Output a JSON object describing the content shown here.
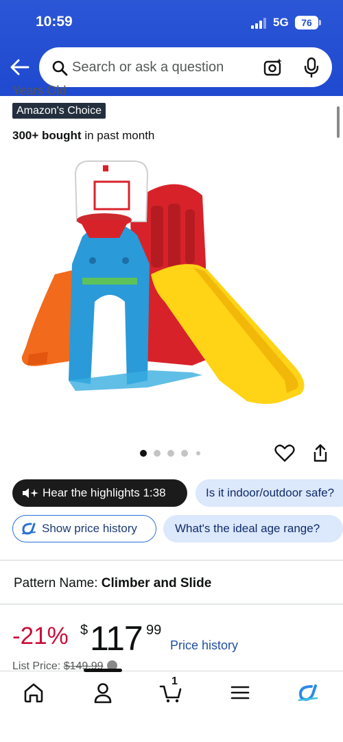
{
  "status": {
    "time": "10:59",
    "network": "5G",
    "battery": "76"
  },
  "search": {
    "placeholder": "Search or ask a question"
  },
  "product": {
    "partial_title": "Years Old",
    "badge": "Amazon's Choice",
    "bought_bold": "300+ bought",
    "bought_rest": " in past month",
    "image_pages": 5,
    "image_current": 1
  },
  "chips": {
    "highlights": "Hear the highlights 1:38",
    "q1": "Is it indoor/outdoor safe?",
    "price_history": "Show price history",
    "q2": "What's the ideal age range?"
  },
  "pattern": {
    "label": "Pattern Name:",
    "value": "Climber and Slide"
  },
  "price": {
    "discount": "-21%",
    "currency": "$",
    "whole": "117",
    "fraction": "99",
    "history_link": "Price history",
    "list_label": "List Price: ",
    "list_value": "$149.99"
  },
  "nav": {
    "cart_count": "1"
  },
  "colors": {
    "header": "#2350d3",
    "discount": "#cc0c39",
    "link": "#1f4fa3",
    "chip": "#dce8fb"
  }
}
